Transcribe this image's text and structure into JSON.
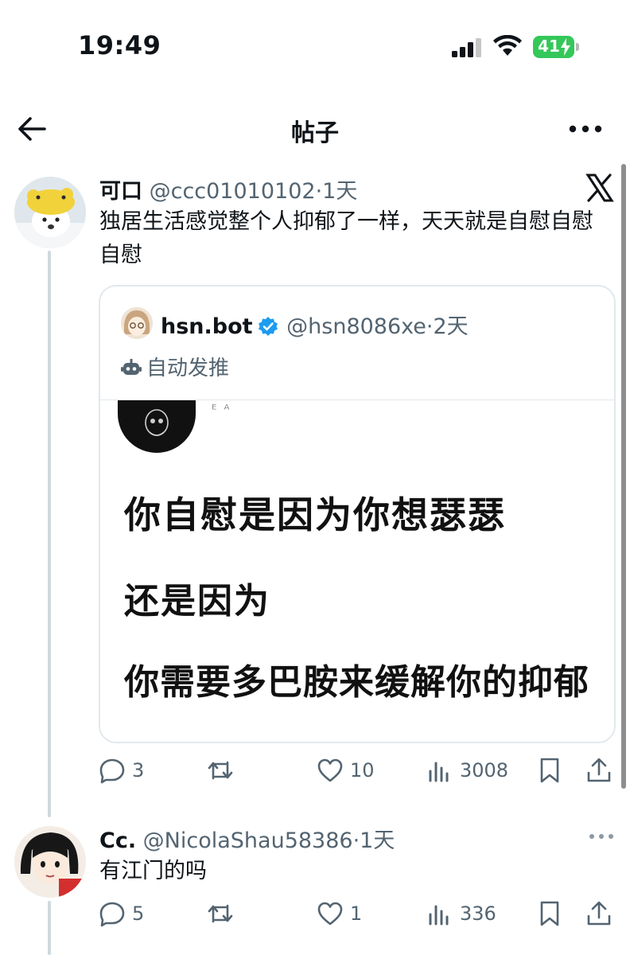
{
  "status_bar": {
    "time": "19:49",
    "battery": "41",
    "battery_color": "#34c759"
  },
  "header": {
    "title": "帖子",
    "back_icon": "arrow-left-icon",
    "more_icon": "more-horizontal-icon"
  },
  "main_post": {
    "name": "可口",
    "handle": "@ccc01010102",
    "time": "·1天",
    "text": "独居生活感觉整个人抑郁了一样，天天就是自慰自慰自慰",
    "source_icon": "x-logo-icon",
    "quote": {
      "name": "hsn.bot",
      "verified": true,
      "handle": "@hsn8086xe",
      "time": "·2天",
      "label": "自动发推",
      "image_small_text": "ᴱ ᴬ",
      "image_lines": [
        "你自慰是因为你想瑟瑟",
        "还是因为",
        "你需要多巴胺来缓解你的抑郁"
      ]
    },
    "stats": {
      "replies": "3",
      "reposts": "",
      "likes": "10",
      "views": "3008"
    }
  },
  "reply": {
    "name": "Cc.",
    "handle": "@NicolaShau58386",
    "time": "·1天",
    "text": "有江门的吗",
    "stats": {
      "replies": "5",
      "reposts": "",
      "likes": "1",
      "views": "336"
    }
  },
  "colors": {
    "text_primary": "#0f1419",
    "text_secondary": "#536471",
    "verified_blue": "#1d9bf0",
    "border": "#e1e8ed"
  }
}
